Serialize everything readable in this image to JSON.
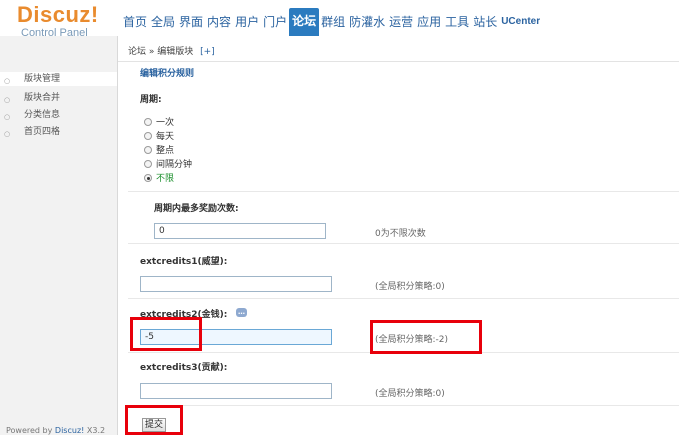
{
  "brand": {
    "name": "Discuz!",
    "subtitle": "Control Panel"
  },
  "nav": {
    "items": [
      "首页",
      "全局",
      "界面",
      "内容",
      "用户",
      "门户",
      "论坛",
      "群组",
      "防灌水",
      "运营",
      "应用",
      "工具",
      "站长",
      "UCenter"
    ],
    "active_index": 6
  },
  "sidebar": {
    "items": [
      "版块管理",
      "版块合并",
      "分类信息",
      "首页四格"
    ],
    "active_index": 0,
    "powered_by": "Powered by",
    "powered_link": "Discuz!",
    "powered_version": "X3.2"
  },
  "breadcrumb": {
    "path": "论坛 » 编辑版块",
    "expand": "[+]"
  },
  "form": {
    "section_title": "编辑积分规则",
    "period": {
      "label": "周期:",
      "options": [
        "一次",
        "每天",
        "整点",
        "间隔分钟",
        "不限"
      ],
      "selected_index": 4
    },
    "max_rewards": {
      "label": "周期内最多奖励次数:",
      "value": "0",
      "hint": "0为不限次数"
    },
    "extcredits1": {
      "label": "extcredits1(威望):",
      "value": "",
      "hint": "(全局积分策略:0)"
    },
    "extcredits2": {
      "label": "extcredits2(金钱):",
      "value": "-5",
      "hint": "(全局积分策略:-2)"
    },
    "extcredits3": {
      "label": "extcredits3(贡献):",
      "value": "",
      "hint": "(全局积分策略:0)"
    },
    "submit_label": "提交"
  },
  "annotations": {
    "highlight_color": "#e8000b"
  }
}
